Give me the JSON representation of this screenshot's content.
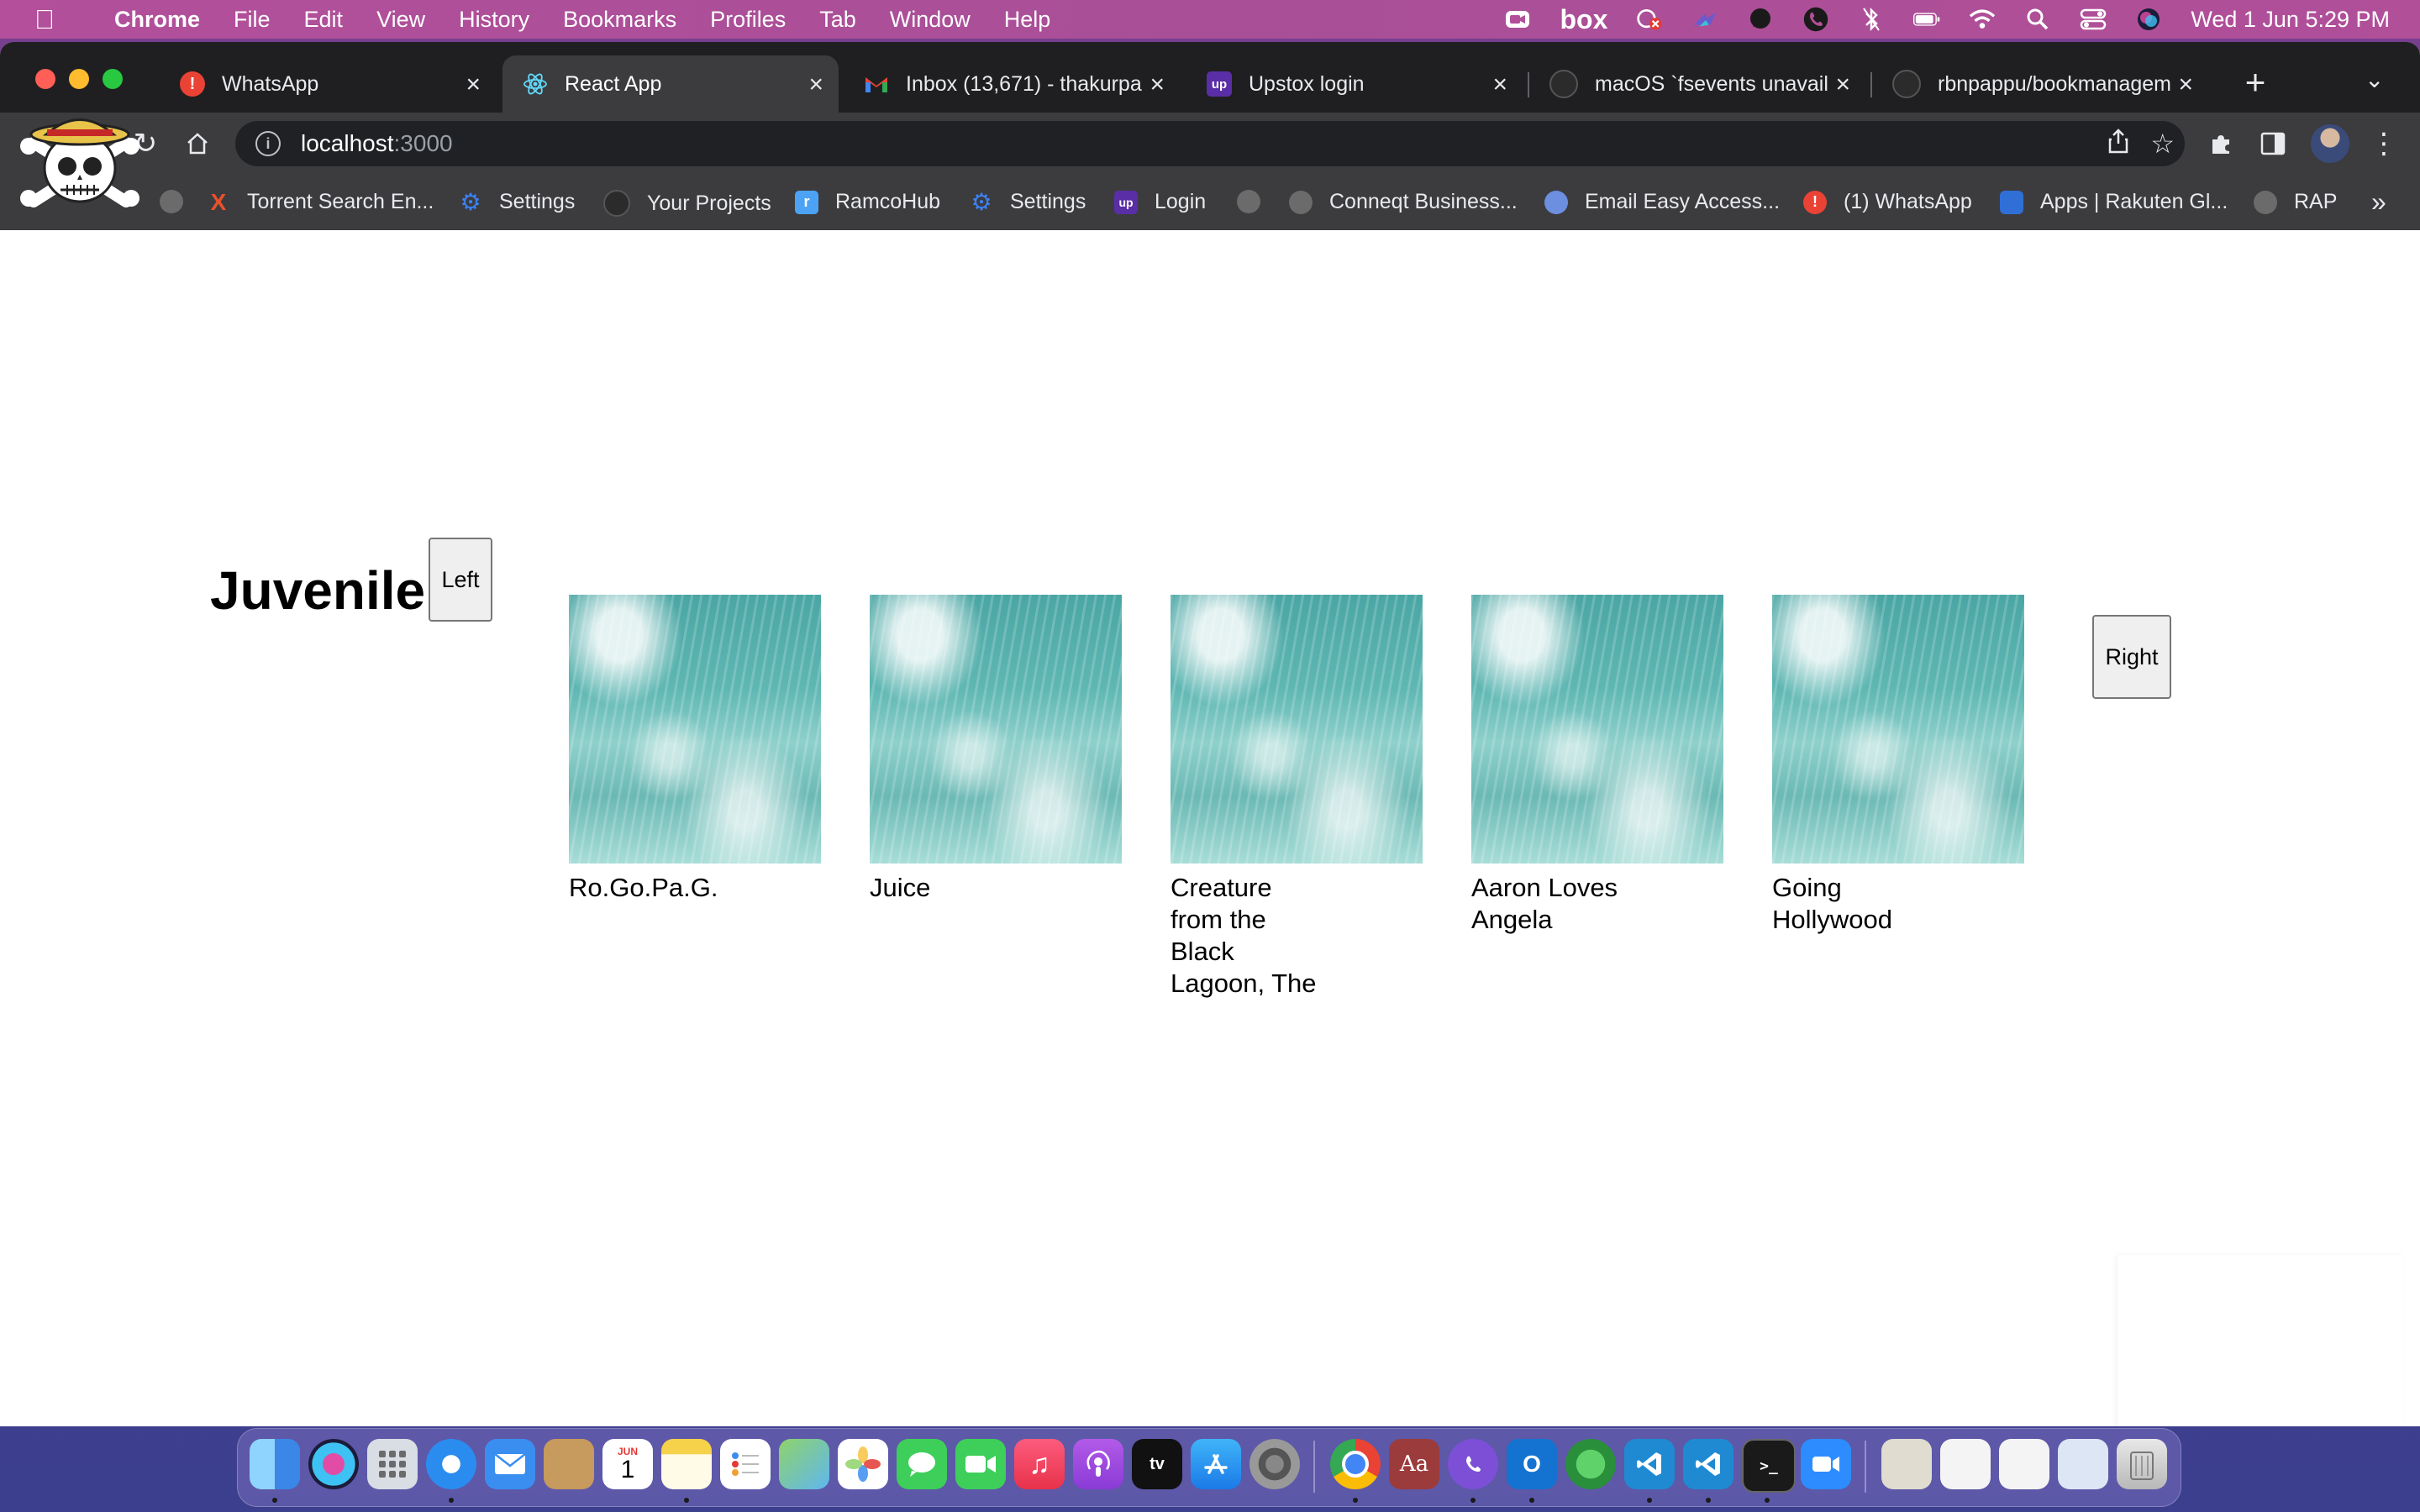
{
  "menubar": {
    "app_name": "Chrome",
    "items": [
      "File",
      "Edit",
      "View",
      "History",
      "Bookmarks",
      "Profiles",
      "Tab",
      "Window",
      "Help"
    ],
    "box_label": "box",
    "clock": "Wed 1 Jun  5:29 PM"
  },
  "tabs": [
    {
      "title": "WhatsApp",
      "icon": "alert-icon",
      "color": "#ea4335"
    },
    {
      "title": "React App",
      "icon": "react-icon",
      "color": "#61dafb"
    },
    {
      "title": "Inbox (13,671) - thakurpa",
      "icon": "gmail-icon",
      "color": "#ea4335"
    },
    {
      "title": "Upstox login",
      "icon": "upstox-icon",
      "color": "#5a2ea6"
    },
    {
      "title": "macOS `fsevents unavail",
      "icon": "github-icon",
      "color": "#2b2b2b"
    },
    {
      "title": "rbnpappu/bookmanagem",
      "icon": "github-icon",
      "color": "#2b2b2b"
    }
  ],
  "omnibox": {
    "host": "localhost",
    "port": ":3000"
  },
  "bookmarks": [
    {
      "label": "Torrent Search En...",
      "icon": "x-icon",
      "color": "#e8512a"
    },
    {
      "label": "Settings",
      "icon": "gear-icon",
      "color": "#3b82f6"
    },
    {
      "label": "Your Projects",
      "icon": "github-icon",
      "color": "#2b2b2b"
    },
    {
      "label": "RamcoHub",
      "icon": "ramco-icon",
      "color": "#4ca3f5"
    },
    {
      "label": "Settings",
      "icon": "gear-icon",
      "color": "#3b82f6"
    },
    {
      "label": "Login",
      "icon": "upstox-icon",
      "color": "#5a2ea6"
    },
    {
      "label": "Conneqt Business...",
      "icon": "globe-icon",
      "color": "#6b6b6b"
    },
    {
      "label": "Email Easy Access...",
      "icon": "email-icon",
      "color": "#6d8fe0"
    },
    {
      "label": "(1) WhatsApp",
      "icon": "alert-icon",
      "color": "#ea4335"
    },
    {
      "label": "Apps | Rakuten Gl...",
      "icon": "shield-icon",
      "color": "#2f6fd6"
    },
    {
      "label": "RAP",
      "icon": "globe-icon",
      "color": "#6b6b6b"
    }
  ],
  "page": {
    "genre": "Juvenile",
    "left_button": "Left",
    "right_button": "Right",
    "movies": [
      {
        "title": "Ro.Go.Pa.G."
      },
      {
        "title": "Juice"
      },
      {
        "title": "Creature from the Black Lagoon, The"
      },
      {
        "title": "Aaron Loves Angela"
      },
      {
        "title": "Going Hollywood"
      }
    ]
  },
  "dock": {
    "apps": [
      "finder",
      "siri",
      "launchpad",
      "safari",
      "mail",
      "contacts",
      "calendar",
      "notes",
      "reminders",
      "maps",
      "photos",
      "messages",
      "facetime",
      "music",
      "podcasts",
      "tv",
      "app-store",
      "system-preferences",
      "chrome",
      "dictionary",
      "viber",
      "outlook",
      "network",
      "vscode",
      "vscode-insiders",
      "terminal",
      "zoom"
    ],
    "calendar_month": "JUN",
    "calendar_day": "1"
  }
}
